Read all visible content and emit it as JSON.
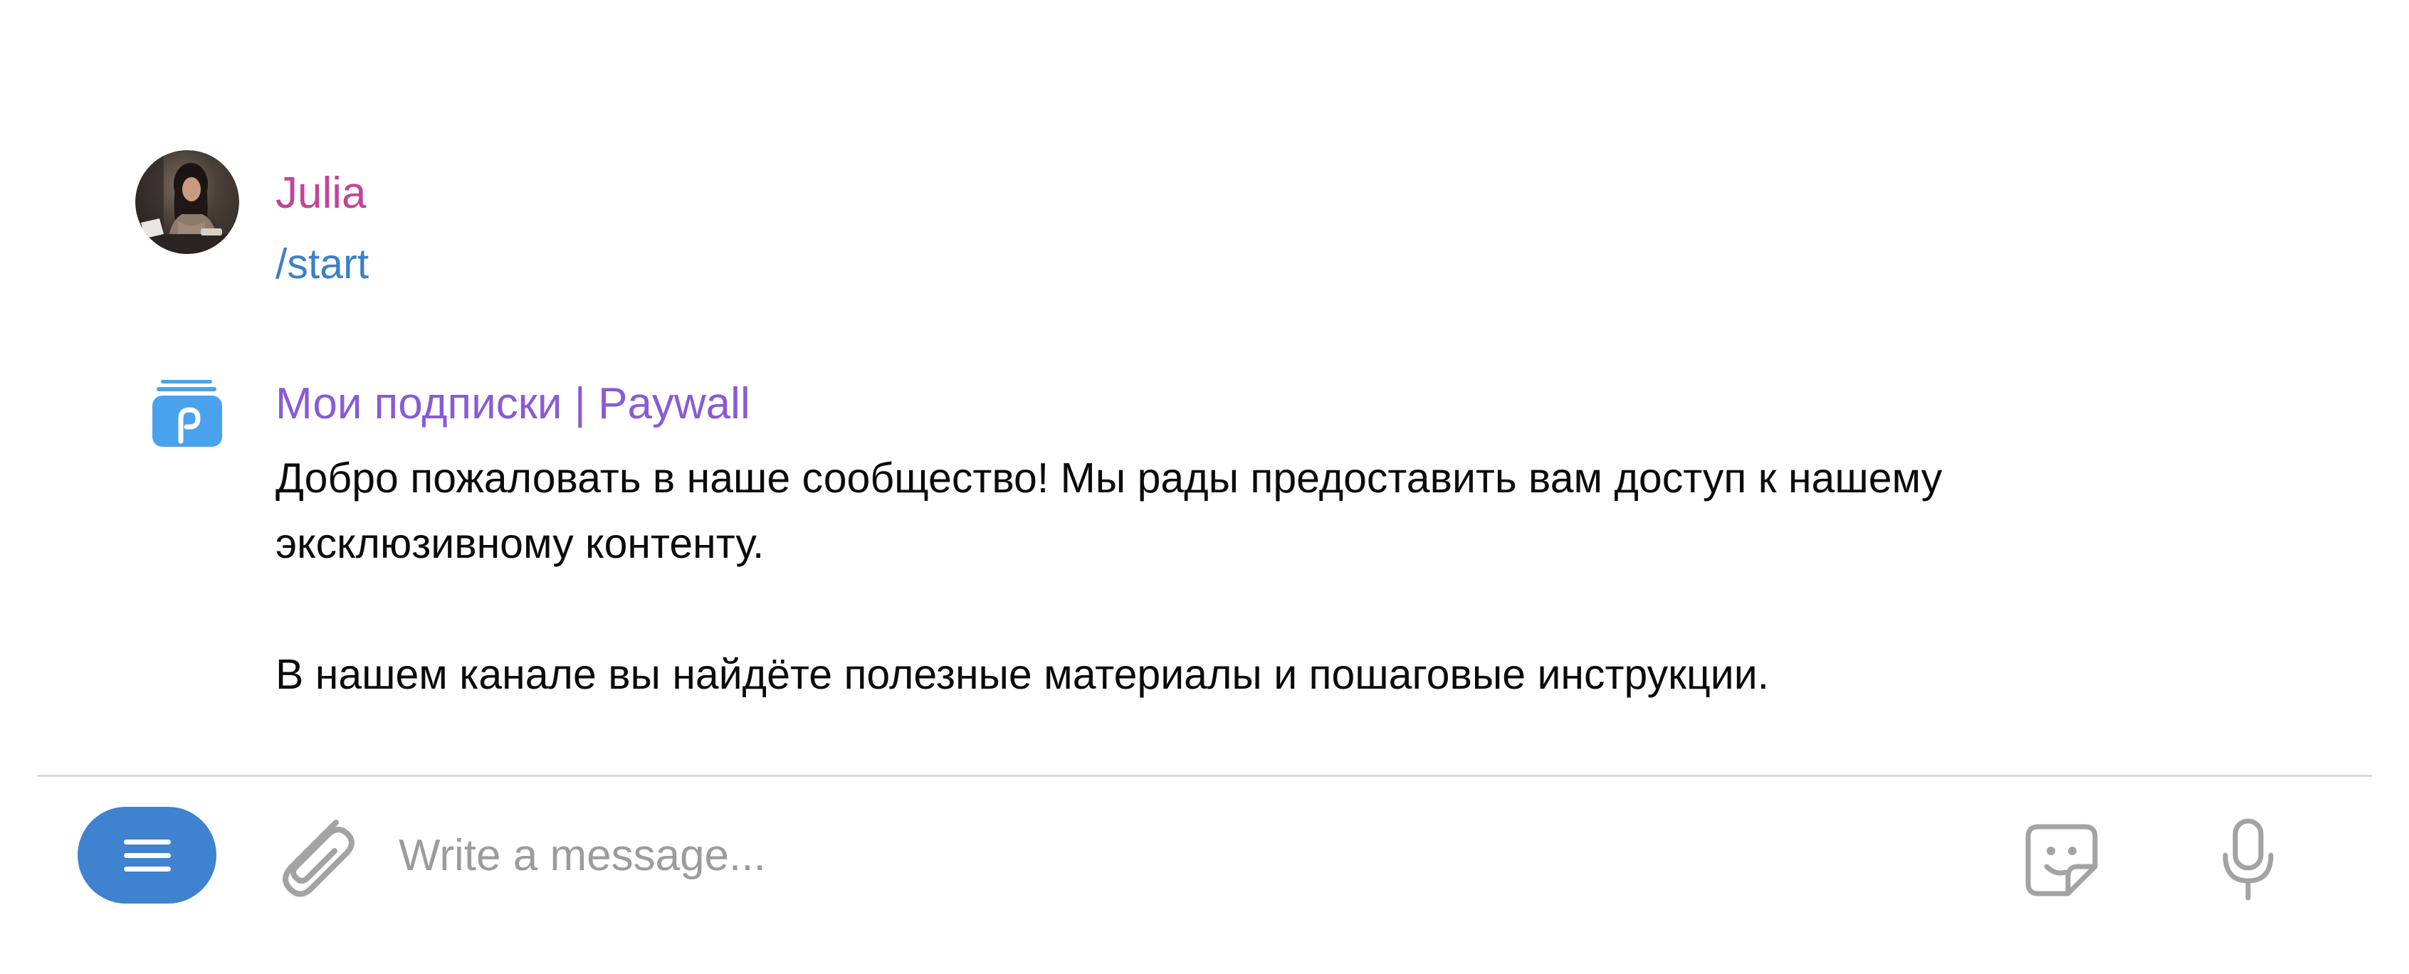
{
  "messages": [
    {
      "sender": "Julia",
      "sender_color": "#c2449a",
      "avatar_icon": "user-photo",
      "text": "/start"
    },
    {
      "sender": "Мои подписки | Paywall",
      "sender_color": "#8a5ad6",
      "avatar_icon": "paywall-logo",
      "paragraphs": [
        [
          "Добро пожаловать в наше сообщество! Мы рады предоставить вам доступ к нашему",
          "эксклюзивному контенту."
        ],
        [
          "В нашем канале вы найдёте полезные материалы и пошаговые инструкции."
        ]
      ]
    }
  ],
  "composer": {
    "menu_icon": "menu-icon",
    "attach_icon": "paperclip-icon",
    "placeholder": "Write a message...",
    "value": "",
    "sticker_icon": "sticker-icon",
    "mic_icon": "microphone-icon"
  },
  "colors": {
    "accent": "#3f82cf",
    "command_link": "#3a80c8",
    "icon_gray": "#a3a3a3"
  }
}
